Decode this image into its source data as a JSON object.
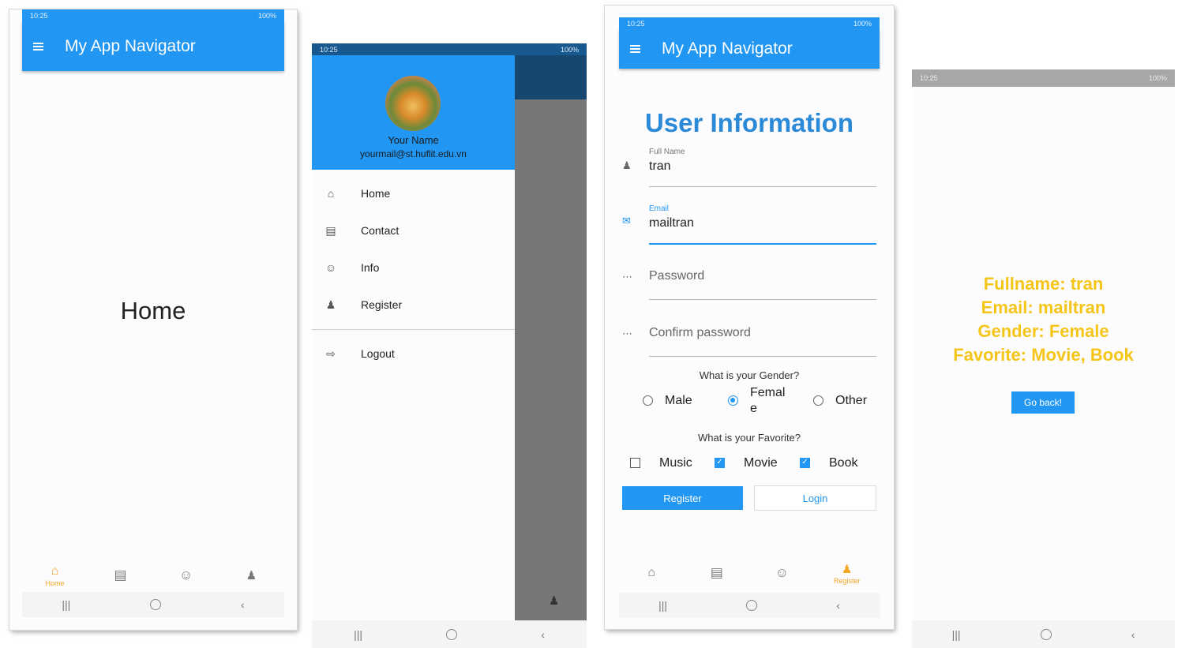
{
  "colors": {
    "primary": "#2196f3",
    "accent": "#f5a623",
    "overlay": "#777777"
  },
  "status": {
    "time_a": "10:25",
    "time_b": "10:25",
    "battery": "100%"
  },
  "screen1": {
    "app_title": "My App Navigator",
    "body_text": "Home",
    "tabs": [
      {
        "icon": "home-icon",
        "label": "Home",
        "active": true
      },
      {
        "icon": "contact-card-icon"
      },
      {
        "icon": "info-icon"
      },
      {
        "icon": "person-icon"
      }
    ]
  },
  "screen2": {
    "user_name": "Your Name",
    "user_email": "yourmail@st.huflit.edu.vn",
    "items": [
      {
        "icon": "home-icon",
        "label": "Home"
      },
      {
        "icon": "contact-card-icon",
        "label": "Contact"
      },
      {
        "icon": "info-icon",
        "label": "Info"
      },
      {
        "icon": "person-icon",
        "label": "Register"
      },
      {
        "icon": "logout-icon",
        "label": "Logout"
      }
    ]
  },
  "screen3": {
    "app_title": "My App Navigator",
    "heading": "User Information",
    "fullname_label": "Full Name",
    "fullname_value": "tran",
    "email_label": "Email",
    "email_value": "mailtran",
    "password_placeholder": "Password",
    "confirm_placeholder": "Confirm password",
    "gender_question": "What is your Gender?",
    "gender_options": [
      "Male",
      "Femal",
      "e",
      "Other"
    ],
    "gender_selected": "Female",
    "favorite_question": "What is your Favorite?",
    "favorite_options": [
      "Music",
      "Movie",
      "Book"
    ],
    "favorite_checked": [
      "Movie",
      "Book"
    ],
    "register_label": "Register",
    "login_label": "Login",
    "tabs": [
      {
        "icon": "home-icon"
      },
      {
        "icon": "contact-card-icon"
      },
      {
        "icon": "info-icon"
      },
      {
        "icon": "person-icon",
        "label": "Register",
        "active": true
      }
    ]
  },
  "screen4": {
    "lines": [
      "Fullname: tran",
      "Email: mailtran",
      "Gender: Female",
      "Favorite: Movie, Book"
    ],
    "go_back_label": "Go back!"
  }
}
